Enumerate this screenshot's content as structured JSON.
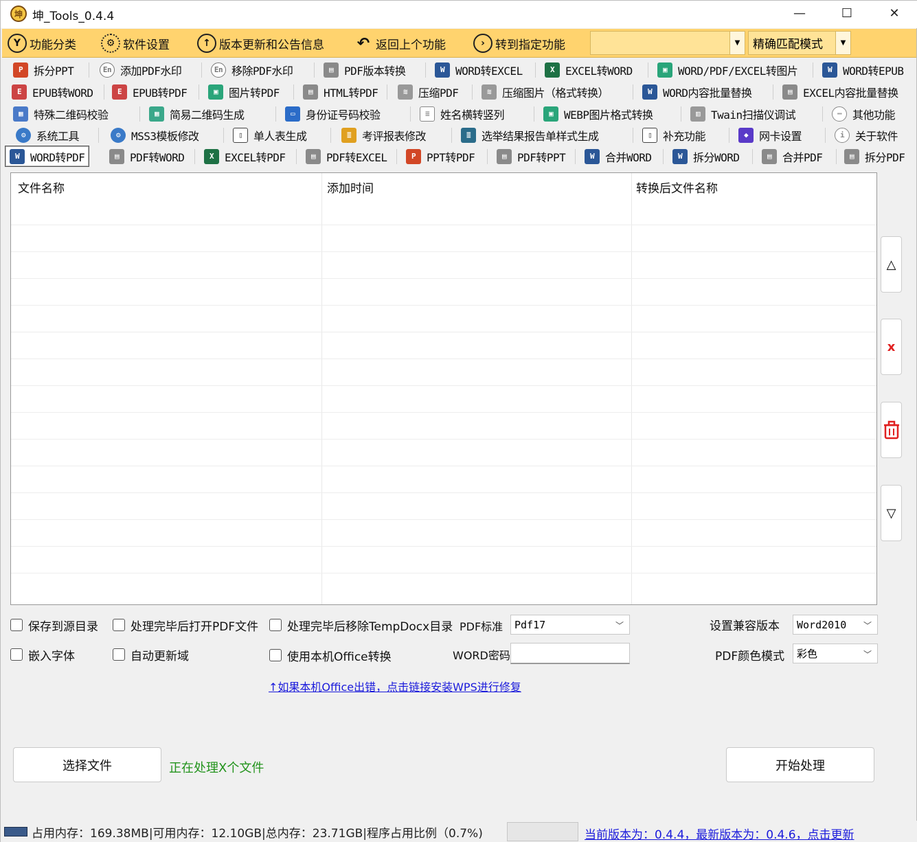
{
  "window": {
    "title": "坤_Tools_0.4.4",
    "minimize": "—",
    "maximize": "☐",
    "close": "✕"
  },
  "toolbar": {
    "items": [
      {
        "label": "功能分类",
        "icon": "Y"
      },
      {
        "label": "软件设置",
        "icon": "⚙"
      },
      {
        "label": "版本更新和公告信息",
        "icon": "↑"
      },
      {
        "label": "返回上个功能",
        "icon": "↶"
      },
      {
        "label": "转到指定功能",
        "icon": "›"
      }
    ],
    "search_value": "",
    "mode_value": "精确匹配模式"
  },
  "tab_rows": [
    [
      {
        "label": "拆分PPT",
        "icon": "ppt"
      },
      {
        "label": "添加PDF水印",
        "icon": "wm"
      },
      {
        "label": "移除PDF水印",
        "icon": "wm"
      },
      {
        "label": "PDF版本转换",
        "icon": "pdf"
      },
      {
        "label": "WORD转EXCEL",
        "icon": "word"
      },
      {
        "label": "EXCEL转WORD",
        "icon": "excel"
      },
      {
        "label": "WORD/PDF/EXCEL转图片",
        "icon": "img"
      },
      {
        "label": "WORD转EPUB",
        "icon": "word"
      }
    ],
    [
      {
        "label": "EPUB转WORD",
        "icon": "epub"
      },
      {
        "label": "EPUB转PDF",
        "icon": "epub"
      },
      {
        "label": "图片转PDF",
        "icon": "img"
      },
      {
        "label": "HTML转PDF",
        "icon": "pdf"
      },
      {
        "label": "压缩PDF",
        "icon": "zip"
      },
      {
        "label": "压缩图片（格式转换）",
        "icon": "zip"
      },
      {
        "label": "WORD内容批量替换",
        "icon": "word"
      },
      {
        "label": "EXCEL内容批量替换",
        "icon": "pdf"
      }
    ],
    [
      {
        "label": "特殊二维码校验",
        "icon": "qr"
      },
      {
        "label": "简易二维码生成",
        "icon": "qr"
      },
      {
        "label": "身份证号码校验",
        "icon": "id"
      },
      {
        "label": "姓名横转竖列",
        "icon": "name"
      },
      {
        "label": "WEBP图片格式转换",
        "icon": "img"
      },
      {
        "label": "Twain扫描仪调试",
        "icon": "scan"
      },
      {
        "label": "其他功能",
        "icon": "more"
      }
    ],
    [
      {
        "label": "系统工具",
        "icon": "gear"
      },
      {
        "label": "MSS3模板修改",
        "icon": "gear"
      },
      {
        "label": "单人表生成",
        "icon": "doc"
      },
      {
        "label": "考评报表修改",
        "icon": "doc"
      },
      {
        "label": "选举结果报告单样式生成",
        "icon": "doc"
      },
      {
        "label": "补充功能",
        "icon": "doc"
      },
      {
        "label": "网卡设置",
        "icon": "net"
      },
      {
        "label": "关于软件",
        "icon": "info"
      }
    ],
    [
      {
        "label": "WORD转PDF",
        "icon": "word"
      },
      {
        "label": "PDF转WORD",
        "icon": "pdf"
      },
      {
        "label": "EXCEL转PDF",
        "icon": "excel"
      },
      {
        "label": "PDF转EXCEL",
        "icon": "pdf"
      },
      {
        "label": "PPT转PDF",
        "icon": "ppt"
      },
      {
        "label": "PDF转PPT",
        "icon": "pdf"
      },
      {
        "label": "合并WORD",
        "icon": "word"
      },
      {
        "label": "拆分WORD",
        "icon": "word"
      },
      {
        "label": "合并PDF",
        "icon": "pdf"
      },
      {
        "label": "拆分PDF",
        "icon": "pdf"
      }
    ]
  ],
  "file_table": {
    "columns": [
      "文件名称",
      "添加时间",
      "转换后文件名称"
    ],
    "rows": []
  },
  "side_buttons": {
    "up": "△",
    "remove": "x",
    "clear": "🗑",
    "down": "▽"
  },
  "options": {
    "save_to_source": "保存到源目录",
    "open_pdf_after": "处理完毕后打开PDF文件",
    "remove_temp_after": "处理完毕后移除TempDocx目录",
    "embed_fonts": "嵌入字体",
    "auto_update_fields": "自动更新域",
    "use_local_office": "使用本机Office转换",
    "pdf_standard_label": "PDF标准",
    "pdf_standard_value": "Pdf17",
    "word_password_label": "WORD密码",
    "word_password_value": "",
    "compat_label": "设置兼容版本",
    "compat_value": "Word2010",
    "color_mode_label": "PDF颜色模式",
    "color_mode_value": "彩色"
  },
  "fix_link": "↑如果本机Office出错，点击链接安装WPS进行修复",
  "buttons": {
    "select_files": "选择文件",
    "start": "开始处理"
  },
  "processing_status": "正在处理X个文件",
  "statusbar": {
    "memory": "占用内存：169.38MB|可用内存：12.10GB|总内存：23.71GB|程序占用比例（0.7%)",
    "update_link": "当前版本为：0.4.4，最新版本为：0.4.6，点击更新"
  },
  "colors": {
    "toolbar_bg": "#ffd36e",
    "link": "#1a1adb",
    "status_green": "#22931c",
    "remove_red": "#e02020"
  }
}
